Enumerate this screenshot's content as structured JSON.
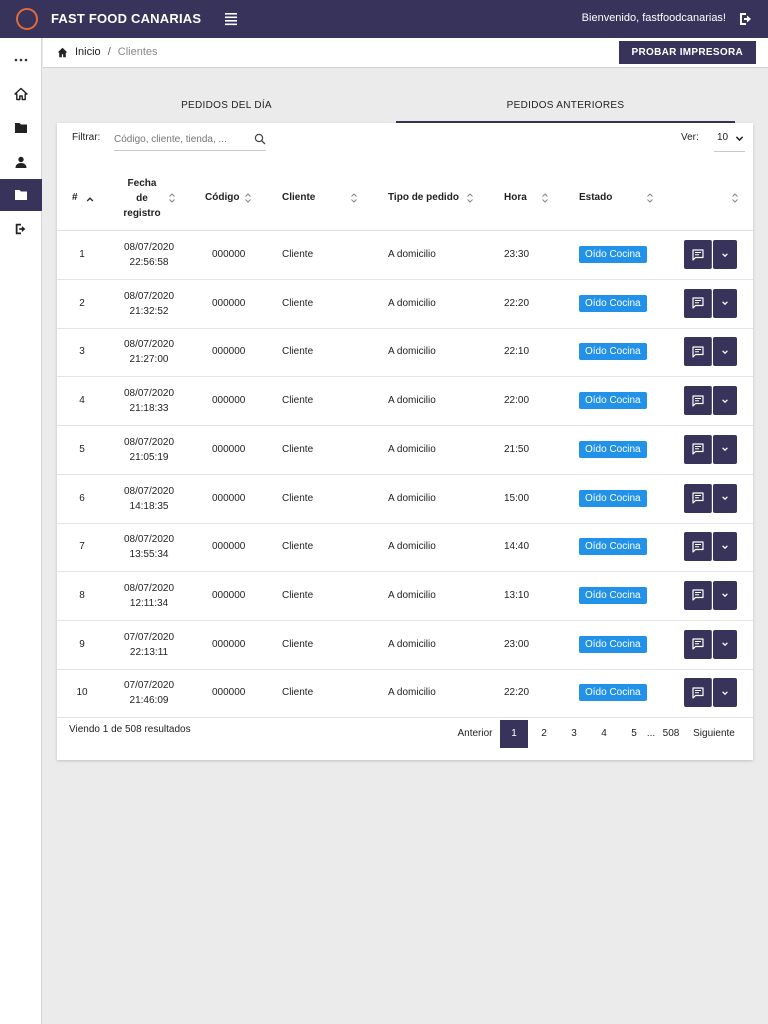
{
  "app": {
    "brand": "FAST FOOD CANARIAS",
    "welcome": "Bienvenido, fastfoodcanarias!"
  },
  "breadcrumb": {
    "home": "Inicio",
    "separator": "/",
    "current": "Clientes"
  },
  "actions": {
    "print_test": "PROBAR IMPRESORA"
  },
  "tabs": [
    {
      "label": "PEDIDOS DEL DÍA"
    },
    {
      "label": "PEDIDOS ANTERIORES"
    }
  ],
  "filter": {
    "label": "Filtrar:",
    "placeholder": "Código, cliente, tienda, ..."
  },
  "view": {
    "label": "Ver:",
    "value": "10"
  },
  "table": {
    "headers": {
      "num": "#",
      "date_l1": "Fecha",
      "date_l2": "de",
      "date_l3": "registro",
      "code": "Código",
      "client": "Cliente",
      "type": "Tipo de pedido",
      "hour": "Hora",
      "status": "Estado"
    },
    "rows": [
      {
        "num": "1",
        "date": "08/07/2020",
        "time": "22:56:58",
        "code": "000000",
        "client": "Cliente",
        "type": "A domicilio",
        "hour": "23:30",
        "status": "Oído Cocina"
      },
      {
        "num": "2",
        "date": "08/07/2020",
        "time": "21:32:52",
        "code": "000000",
        "client": "Cliente",
        "type": "A domicilio",
        "hour": "22:20",
        "status": "Oído Cocina"
      },
      {
        "num": "3",
        "date": "08/07/2020",
        "time": "21:27:00",
        "code": "000000",
        "client": "Cliente",
        "type": "A domicilio",
        "hour": "22:10",
        "status": "Oído Cocina"
      },
      {
        "num": "4",
        "date": "08/07/2020",
        "time": "21:18:33",
        "code": "000000",
        "client": "Cliente",
        "type": "A domicilio",
        "hour": "22:00",
        "status": "Oído Cocina"
      },
      {
        "num": "5",
        "date": "08/07/2020",
        "time": "21:05:19",
        "code": "000000",
        "client": "Cliente",
        "type": "A domicilio",
        "hour": "21:50",
        "status": "Oído Cocina"
      },
      {
        "num": "6",
        "date": "08/07/2020",
        "time": "14:18:35",
        "code": "000000",
        "client": "Cliente",
        "type": "A domicilio",
        "hour": "15:00",
        "status": "Oído Cocina"
      },
      {
        "num": "7",
        "date": "08/07/2020",
        "time": "13:55:34",
        "code": "000000",
        "client": "Cliente",
        "type": "A domicilio",
        "hour": "14:40",
        "status": "Oído Cocina"
      },
      {
        "num": "8",
        "date": "08/07/2020",
        "time": "12:11:34",
        "code": "000000",
        "client": "Cliente",
        "type": "A domicilio",
        "hour": "13:10",
        "status": "Oído Cocina"
      },
      {
        "num": "9",
        "date": "07/07/2020",
        "time": "22:13:11",
        "code": "000000",
        "client": "Cliente",
        "type": "A domicilio",
        "hour": "23:00",
        "status": "Oído Cocina"
      },
      {
        "num": "10",
        "date": "07/07/2020",
        "time": "21:46:09",
        "code": "000000",
        "client": "Cliente",
        "type": "A domicilio",
        "hour": "22:20",
        "status": "Oído Cocina"
      }
    ]
  },
  "footer": {
    "results": "Viendo 1 de 508 resultados"
  },
  "pagination": {
    "prev": "Anterior",
    "pages": [
      "1",
      "2",
      "3",
      "4",
      "5"
    ],
    "ellipsis": "...",
    "last": "508",
    "next": "Siguiente",
    "active": "1"
  },
  "colors": {
    "primary": "#37335a",
    "badge": "#2291e8",
    "logo_ring": "#e06a3b"
  },
  "icons": {
    "menu": "hamburger-icon",
    "logout": "logout-icon",
    "home": "home-icon",
    "folder": "folder-icon",
    "user": "user-icon",
    "search": "search-icon",
    "comment": "comment-icon",
    "chevron": "chevron-down-icon"
  }
}
